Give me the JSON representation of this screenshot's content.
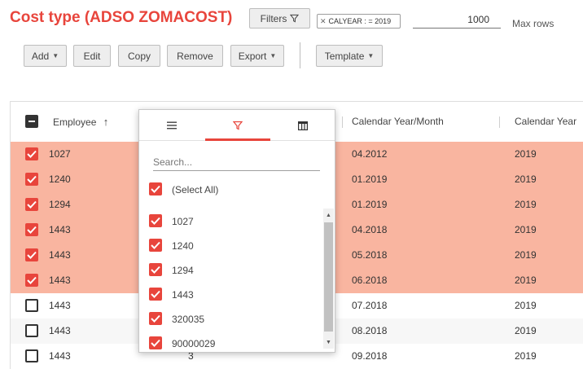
{
  "page": {
    "title": "Cost type (ADSO ZOMACOST)"
  },
  "header": {
    "filters_label": "Filters",
    "filter_chip": {
      "label": "CALYEAR : = 2019"
    },
    "max_rows_value": "1000",
    "max_rows_label": "Max rows"
  },
  "toolbar": {
    "add": "Add",
    "edit": "Edit",
    "copy": "Copy",
    "remove": "Remove",
    "export": "Export",
    "template": "Template"
  },
  "grid": {
    "columns": {
      "employee": "Employee",
      "month": "Calendar Year/Month",
      "year": "Calendar Year"
    },
    "rows": [
      {
        "employee": "1027",
        "mid": "",
        "month": "04.2012",
        "year": "2019",
        "selected": true
      },
      {
        "employee": "1240",
        "mid": "",
        "month": "01.2019",
        "year": "2019",
        "selected": true
      },
      {
        "employee": "1294",
        "mid": "",
        "month": "01.2019",
        "year": "2019",
        "selected": true
      },
      {
        "employee": "1443",
        "mid": "",
        "month": "04.2018",
        "year": "2019",
        "selected": true
      },
      {
        "employee": "1443",
        "mid": "",
        "month": "05.2018",
        "year": "2019",
        "selected": true
      },
      {
        "employee": "1443",
        "mid": "",
        "month": "06.2018",
        "year": "2019",
        "selected": true
      },
      {
        "employee": "1443",
        "mid": "",
        "month": "07.2018",
        "year": "2019",
        "selected": false
      },
      {
        "employee": "1443",
        "mid": "",
        "month": "08.2018",
        "year": "2019",
        "selected": false
      },
      {
        "employee": "1443",
        "mid": "3",
        "month": "09.2018",
        "year": "2019",
        "selected": false
      }
    ]
  },
  "filter_popup": {
    "tabs": [
      {
        "icon": "menu-icon"
      },
      {
        "icon": "filter-icon"
      },
      {
        "icon": "columns-icon"
      }
    ],
    "search_placeholder": "Search...",
    "select_all": "(Select All)",
    "options": [
      "1027",
      "1240",
      "1294",
      "1443",
      "320035",
      "90000029"
    ]
  },
  "colors": {
    "accent": "#e8453c",
    "selected_row": "#f9b5a0"
  }
}
